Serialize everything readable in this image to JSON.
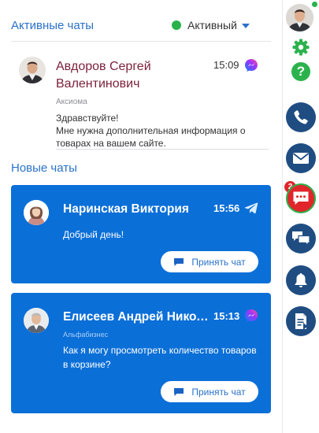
{
  "active_chats": {
    "title": "Активные чаты",
    "status": {
      "label": "Активный",
      "color": "#2bb24c"
    },
    "items": [
      {
        "name": "Авдоров Сергей Валентинович",
        "time": "15:09",
        "channel": "messenger-icon",
        "organization": "Аксиома",
        "message": "Здравствуйте!\nМне нужна дополнительная информация о товарах на вашем сайте."
      }
    ]
  },
  "new_chats": {
    "title": "Новые чаты",
    "items": [
      {
        "name": "Наринская Виктория",
        "time": "15:56",
        "channel": "telegram-icon",
        "message": "Добрый день!",
        "accept_label": "Принять чат"
      },
      {
        "name": "Елисеев Андрей Николаевич",
        "time": "15:13",
        "channel": "messenger-icon",
        "organization": "Альфабизнес",
        "message": "Как я могу просмотреть количество товаров в корзине?",
        "accept_label": "Принять чат"
      }
    ]
  },
  "sidebar": {
    "help_label": "?",
    "chat_badge": "2",
    "buttons": [
      "phone-icon",
      "mail-icon",
      "chat-icon",
      "chats-icon",
      "bell-icon",
      "document-icon"
    ]
  },
  "colors": {
    "accent": "#2a72c8",
    "card": "#0b6fd8",
    "sidebar_button": "#1f4d82",
    "alert": "#e0262b",
    "online": "#2bb24c",
    "name_active": "#7b1f3c"
  }
}
